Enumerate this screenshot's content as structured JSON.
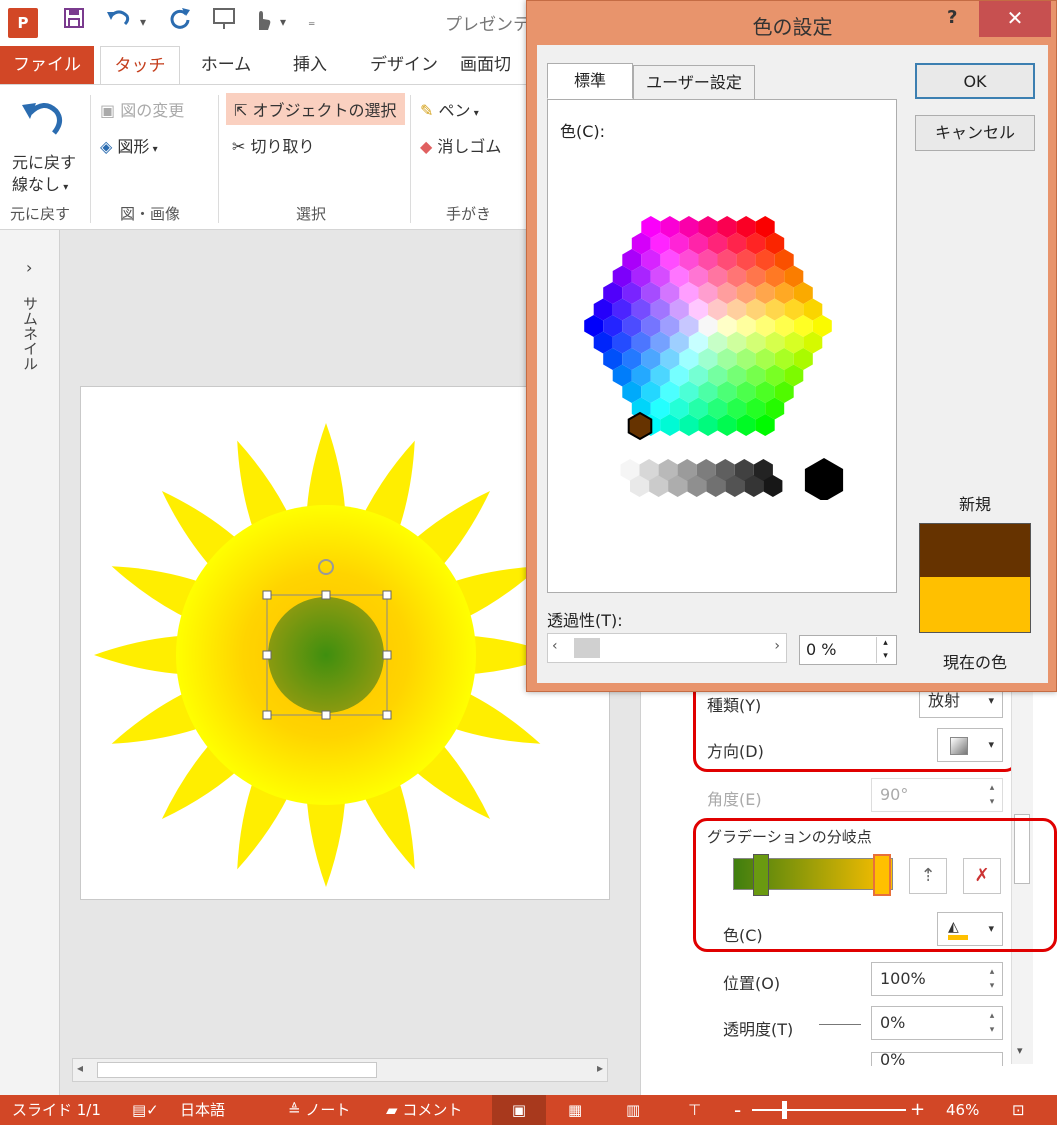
{
  "window": {
    "title": "プレゼンテ",
    "quick_access": [
      "save-icon",
      "undo-icon",
      "redo-icon",
      "touch-mode-icon"
    ]
  },
  "ribbon": {
    "tabs": [
      {
        "label": "ファイル"
      },
      {
        "label": "タッチ"
      },
      {
        "label": "ホーム"
      },
      {
        "label": "挿入"
      },
      {
        "label": "デザイン"
      },
      {
        "label": "画面切"
      }
    ],
    "undo_group": {
      "undo_label": "元に戻す",
      "line_label": "線なし",
      "group_label": "元に戻す"
    },
    "image_group": {
      "change_picture": "図の変更",
      "shapes": "図形",
      "group_label": "図・画像"
    },
    "select_group": {
      "select_objects": "オブジェクトの選択",
      "cut": "切り取り",
      "group_label": "選択"
    },
    "ink_group": {
      "pen": "ペン",
      "eraser": "消しゴム",
      "group_label": "手がき"
    }
  },
  "sidebar": {
    "label": "サムネイル",
    "toggle": "›"
  },
  "format_pane": {
    "type_label": "種類(Y)",
    "type_value": "放射",
    "direction_label": "方向(D)",
    "angle_label": "角度(E)",
    "angle_value": "90°",
    "stops_label": "グラデーションの分岐点",
    "color_label": "色(C)",
    "position_label": "位置(O)",
    "position_value": "100%",
    "transparency_label": "透明度(T)",
    "transparency_value": "0%",
    "brightness_value": "0%",
    "gradient": {
      "start": "#3f7e0f",
      "end": "#ffc000"
    }
  },
  "dialog": {
    "title": "色の設定",
    "help": "?",
    "close": "✕",
    "tabs": [
      {
        "label": "標準"
      },
      {
        "label": "ユーザー設定"
      }
    ],
    "color_label": "色(C):",
    "transparency_label": "透過性(T):",
    "transparency_value": "0 %",
    "ok": "OK",
    "cancel": "キャンセル",
    "new_label": "新規",
    "current_label": "現在の色",
    "new_color": "#663300",
    "current_color": "#ffc000"
  },
  "status_bar": {
    "slide": "スライド 1/1",
    "language": "日本語",
    "notes": "ノート",
    "comments": "コメント",
    "zoom": "46%"
  }
}
